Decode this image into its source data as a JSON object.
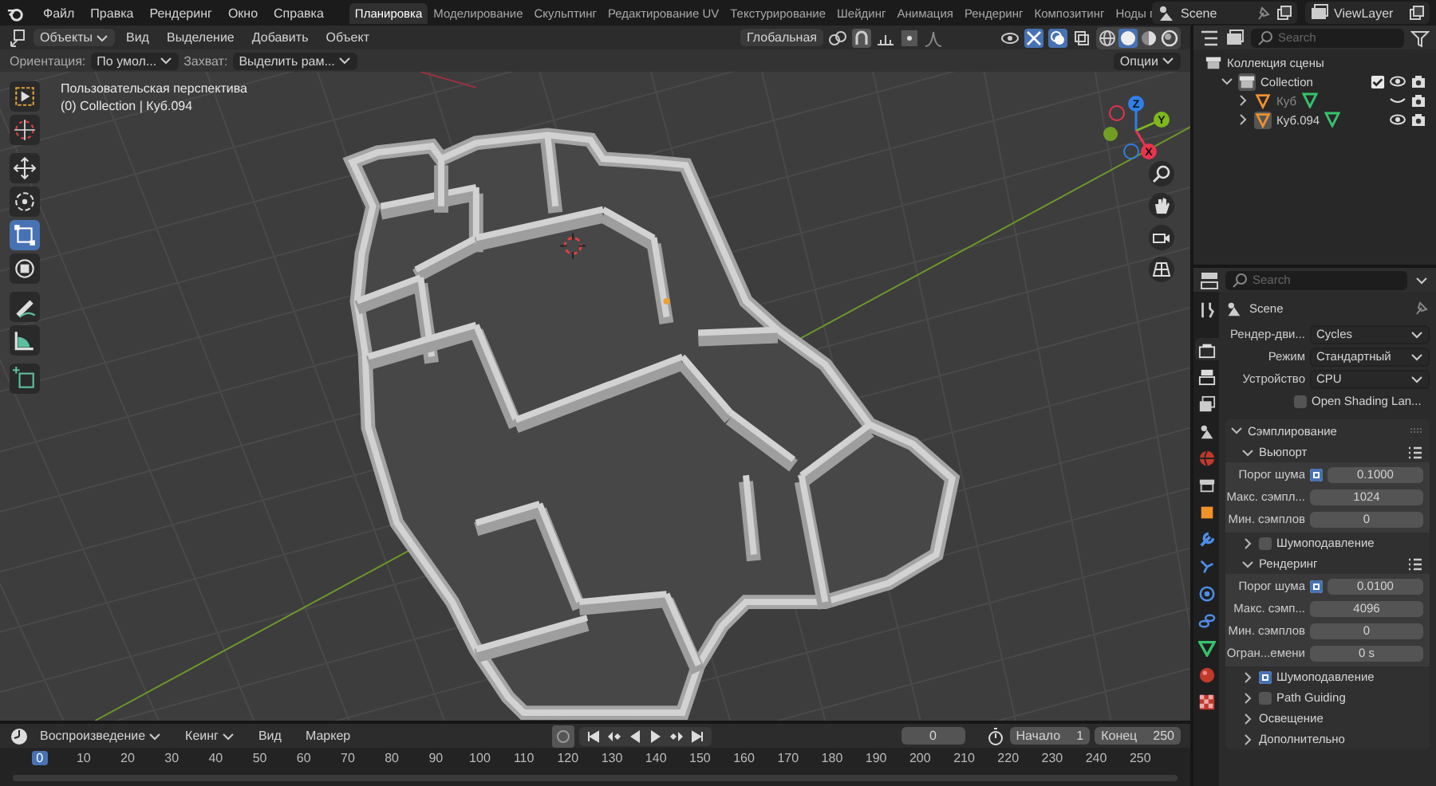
{
  "top_bar": {
    "menus": [
      "Файл",
      "Правка",
      "Рендеринг",
      "Окно",
      "Справка"
    ],
    "workspace_tabs": [
      {
        "label": "Планировка",
        "selected": true
      },
      {
        "label": "Моделирование",
        "selected": false
      },
      {
        "label": "Скульптинг",
        "selected": false
      },
      {
        "label": "Редактирование UV",
        "selected": false
      },
      {
        "label": "Текстурирование",
        "selected": false
      },
      {
        "label": "Шейдинг",
        "selected": false
      },
      {
        "label": "Анимация",
        "selected": false
      },
      {
        "label": "Рендеринг",
        "selected": false
      },
      {
        "label": "Композитинг",
        "selected": false
      },
      {
        "label": "Ноды г",
        "selected": false
      }
    ],
    "scene": "Scene",
    "view_layer": "ViewLayer"
  },
  "viewport": {
    "mode": "Объекты",
    "menus": [
      "Вид",
      "Выделение",
      "Добавить",
      "Объект"
    ],
    "transform_orientation": "Глобальная",
    "gizmo_on": true,
    "overlays_on": true,
    "shading_modes": [
      {
        "kind": "wireframe",
        "selected": false
      },
      {
        "kind": "solid",
        "selected": true
      },
      {
        "kind": "material",
        "selected": false
      },
      {
        "kind": "rendered",
        "selected": false
      }
    ],
    "orientation_label": "Ориентация:",
    "orientation_value": "По умол...",
    "snap_label": "Захват:",
    "snap_value": "Выделить рам...",
    "options": "Опции",
    "overlay_text": [
      "Пользовательская перспектива",
      "(0) Collection | Куб.094"
    ],
    "tools": [
      {
        "kind": "select-box",
        "selected": false
      },
      {
        "kind": "cursor",
        "selected": false
      },
      {
        "kind": "move",
        "selected": false
      },
      {
        "kind": "rotate",
        "selected": false
      },
      {
        "kind": "scale",
        "selected": true
      },
      {
        "kind": "transform",
        "selected": false
      },
      {
        "kind": "annotate",
        "selected": false
      },
      {
        "kind": "measure",
        "selected": false
      },
      {
        "kind": "add-cube",
        "selected": false
      }
    ],
    "axes": [
      {
        "label": "Z",
        "color": "#2f7fe8"
      },
      {
        "label": "Y",
        "color": "#7fb81c"
      },
      {
        "label": "X",
        "color": "#e8344e"
      }
    ]
  },
  "outliner": {
    "search_placeholder": "Search",
    "tree": [
      {
        "label": "Коллекция сцены",
        "kind": "scene-collection",
        "children": [
          {
            "label": "Collection",
            "kind": "collection",
            "expanded": true,
            "checked": true,
            "visible": true,
            "children": [
              {
                "label": "Куб",
                "kind": "mesh",
                "selected": false,
                "expanded": false,
                "visible": false
              },
              {
                "label": "Куб.094",
                "kind": "mesh",
                "selected": true,
                "expanded": false,
                "visible": true
              }
            ]
          }
        ]
      }
    ]
  },
  "properties": {
    "search_placeholder": "Search",
    "tabs": [
      {
        "kind": "tool",
        "selected": false
      },
      {
        "kind": "render",
        "selected": true
      },
      {
        "kind": "output",
        "selected": false
      },
      {
        "kind": "view_layer",
        "selected": false
      },
      {
        "kind": "scene",
        "selected": false
      },
      {
        "kind": "world",
        "selected": false
      },
      {
        "kind": "collection",
        "selected": false
      },
      {
        "kind": "object",
        "selected": false
      },
      {
        "kind": "modifiers",
        "selected": false
      },
      {
        "kind": "particles",
        "selected": false
      },
      {
        "kind": "physics",
        "selected": false
      },
      {
        "kind": "constraints",
        "selected": false
      },
      {
        "kind": "data",
        "selected": false
      },
      {
        "kind": "material",
        "selected": false
      },
      {
        "kind": "texture",
        "selected": false
      }
    ],
    "title": "Scene",
    "fields": [
      {
        "kind": "dropdown",
        "label": "Рендер-дви...",
        "value": "Cycles"
      },
      {
        "kind": "dropdown",
        "label": "Режим",
        "value": "Стандартный"
      },
      {
        "kind": "dropdown",
        "label": "Устройство",
        "value": "CPU"
      },
      {
        "kind": "checkbox",
        "label": "Open Shading Lan...",
        "checked": false
      }
    ],
    "panels": [
      {
        "title": "Сэмплирование",
        "expanded": true,
        "subpanels": [
          {
            "title": "Вьюпорт",
            "expanded": true,
            "rows": [
              {
                "kind": "toggle-number",
                "label": "Порог шума",
                "checked": true,
                "value": "0.1000"
              },
              {
                "kind": "number",
                "label": "Макс. сэмпл...",
                "value": "1024"
              },
              {
                "kind": "number",
                "label": "Мин. сэмплов",
                "value": "0"
              }
            ]
          },
          {
            "title": "Шумоподавление",
            "expanded": false,
            "checked": false
          },
          {
            "title": "Рендеринг",
            "expanded": true,
            "rows": [
              {
                "kind": "toggle-number",
                "label": "Порог шума",
                "checked": true,
                "value": "0.0100"
              },
              {
                "kind": "number",
                "label": "Макс. сэмп...",
                "value": "4096"
              },
              {
                "kind": "number",
                "label": "Мин. сэмплов",
                "value": "0"
              },
              {
                "kind": "number",
                "label": "Огран...емени",
                "value": "0 s"
              }
            ]
          },
          {
            "title": "Шумоподавление",
            "expanded": false,
            "checked": true
          },
          {
            "title": "Path Guiding",
            "expanded": false,
            "checked": false
          },
          {
            "title": "Освещение",
            "expanded": false
          },
          {
            "title": "Дополнительно",
            "expanded": false
          }
        ]
      }
    ]
  },
  "timeline": {
    "menus": [
      "Воспроизведение",
      "Кеинг",
      "Вид",
      "Маркер"
    ],
    "current_frame": "0",
    "start_label": "Начало",
    "start": "1",
    "end_label": "Конец",
    "end": "250",
    "ticks": [
      {
        "label": "0",
        "selected": true
      },
      {
        "label": "10",
        "selected": false
      },
      {
        "label": "20",
        "selected": false
      },
      {
        "label": "30",
        "selected": false
      },
      {
        "label": "40",
        "selected": false
      },
      {
        "label": "50",
        "selected": false
      },
      {
        "label": "60",
        "selected": false
      },
      {
        "label": "70",
        "selected": false
      },
      {
        "label": "80",
        "selected": false
      },
      {
        "label": "90",
        "selected": false
      },
      {
        "label": "100",
        "selected": false
      },
      {
        "label": "110",
        "selected": false
      },
      {
        "label": "120",
        "selected": false
      },
      {
        "label": "130",
        "selected": false
      },
      {
        "label": "140",
        "selected": false
      },
      {
        "label": "150",
        "selected": false
      },
      {
        "label": "160",
        "selected": false
      },
      {
        "label": "170",
        "selected": false
      },
      {
        "label": "180",
        "selected": false
      },
      {
        "label": "190",
        "selected": false
      },
      {
        "label": "200",
        "selected": false
      },
      {
        "label": "210",
        "selected": false
      },
      {
        "label": "220",
        "selected": false
      },
      {
        "label": "230",
        "selected": false
      },
      {
        "label": "240",
        "selected": false
      },
      {
        "label": "250",
        "selected": false
      }
    ]
  }
}
